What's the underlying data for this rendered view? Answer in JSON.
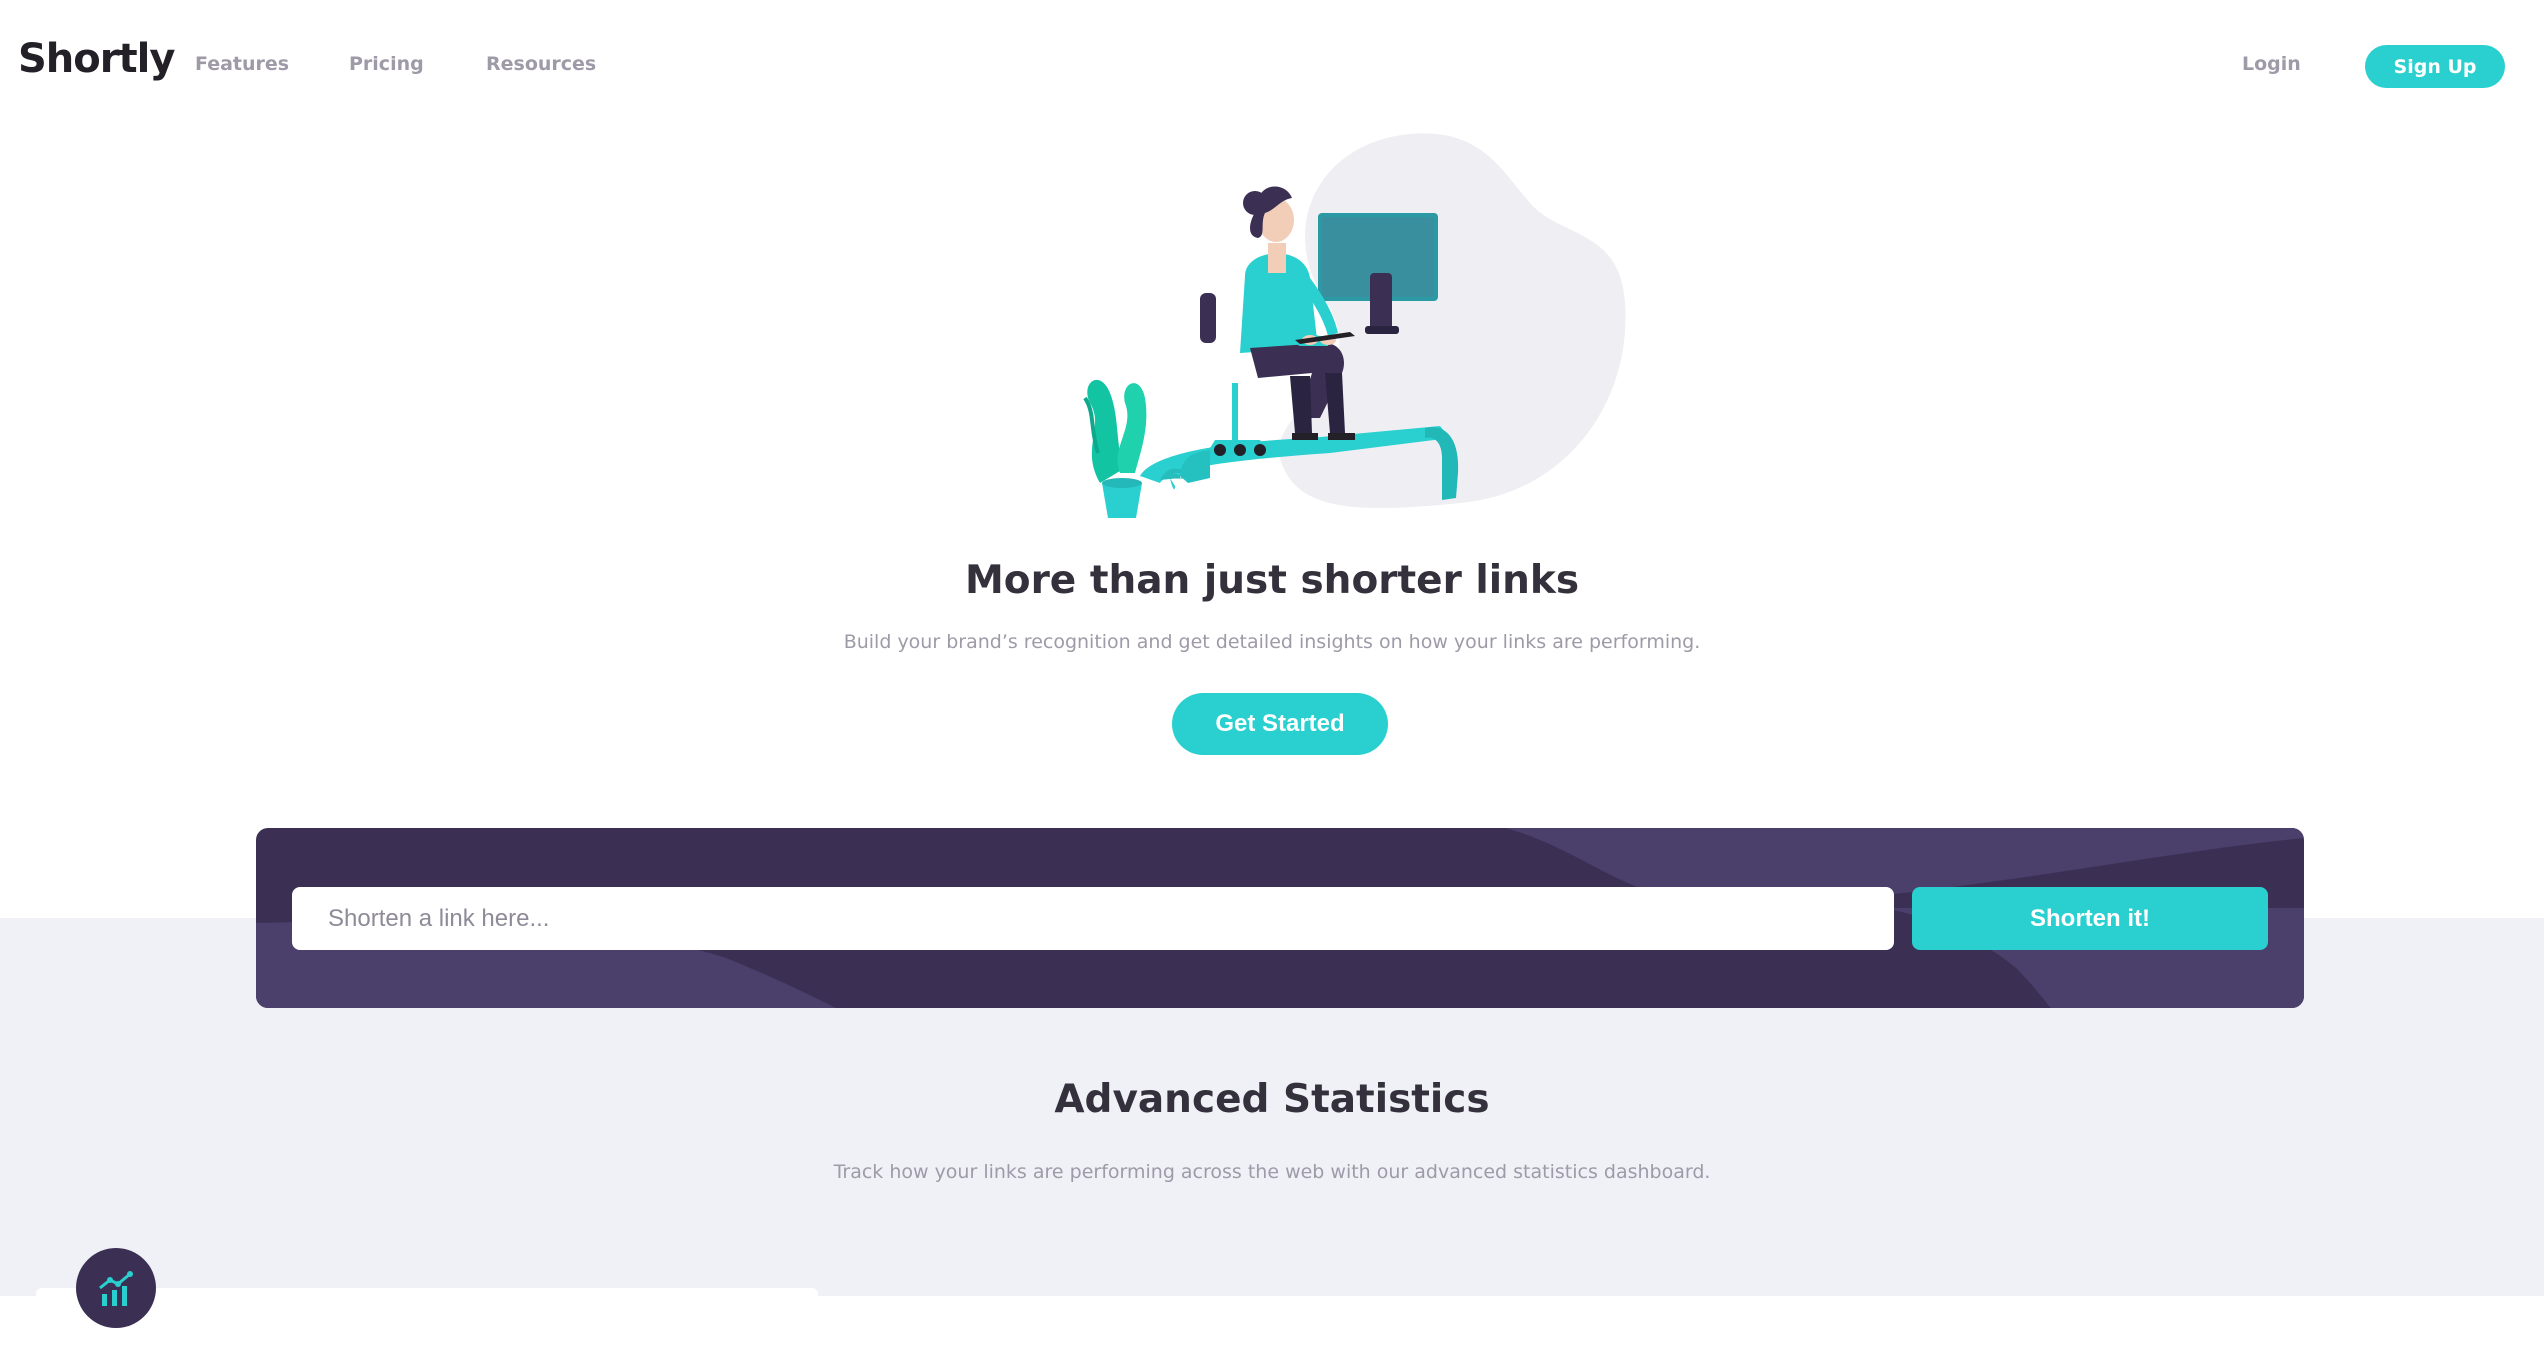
{
  "header": {
    "logo": "Shortly",
    "nav": {
      "features": "Features",
      "pricing": "Pricing",
      "resources": "Resources"
    },
    "login": "Login",
    "signup": "Sign Up"
  },
  "hero": {
    "illustration_icon": "person-working-at-desk-illustration",
    "title": "More than just shorter links",
    "subtitle": "Build your brand’s recognition and get detailed insights on how your links are performing.",
    "cta": "Get Started"
  },
  "shortener": {
    "placeholder": "Shorten a link here...",
    "value": "",
    "button": "Shorten it!"
  },
  "statistics": {
    "title": "Advanced Statistics",
    "subtitle": "Track how your links are performing across the web with our advanced statistics dashboard.",
    "first_card_icon": "chart-icon"
  },
  "colors": {
    "accent": "#2acfcf",
    "dark_violet": "#3b3054",
    "text_dark": "#34313d",
    "text_gray": "#9e9aa7",
    "section_bg": "#eff1f7"
  }
}
